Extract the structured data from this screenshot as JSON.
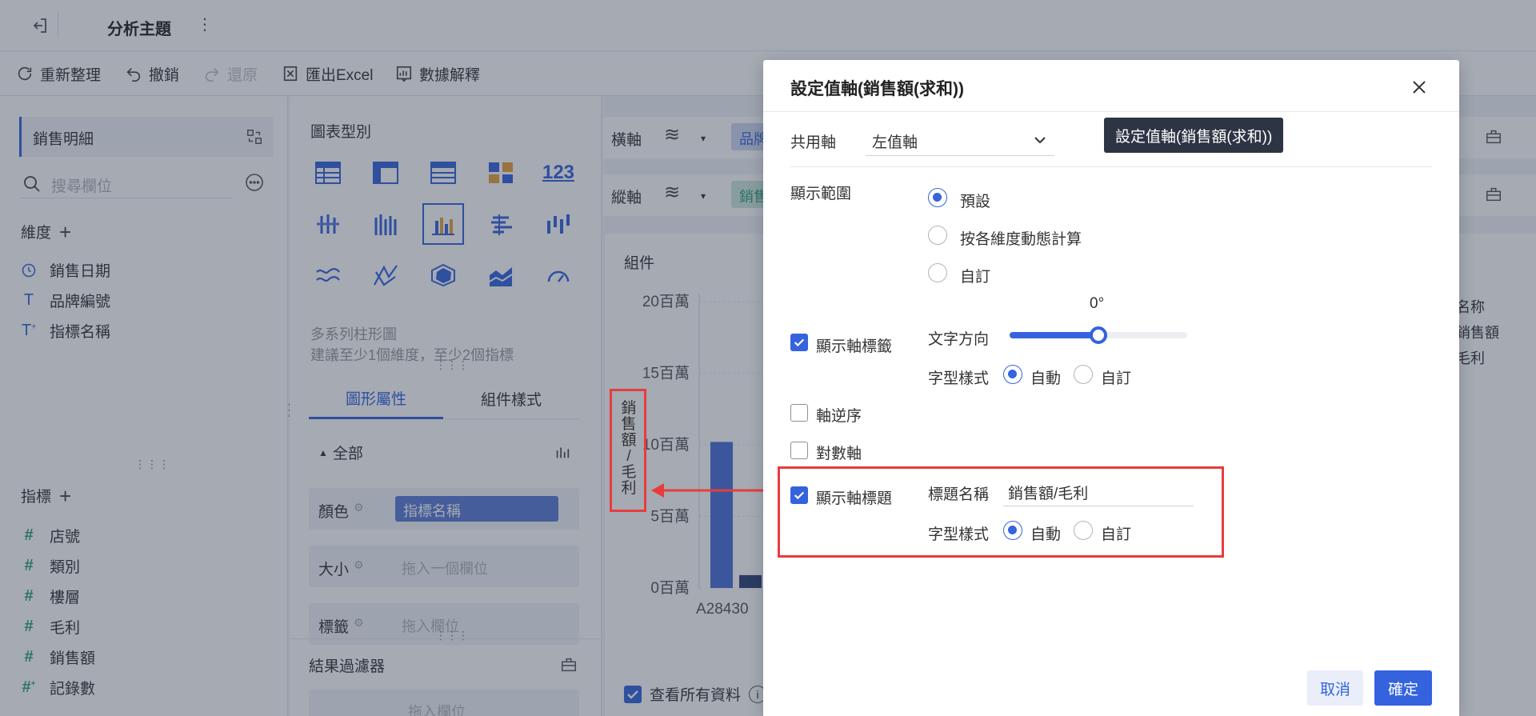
{
  "topbar": {
    "title": "分析主題"
  },
  "toolbar": {
    "refresh": "重新整理",
    "undo": "撤銷",
    "redo": "還原",
    "export": "匯出Excel",
    "explain": "數據解釋"
  },
  "left": {
    "dataset": "銷售明細",
    "search_placeholder": "搜尋欄位",
    "dimensions_label": "維度",
    "dimensions": [
      "銷售日期",
      "品牌編號",
      "指標名稱"
    ],
    "measures_label": "指標",
    "measures": [
      "店號",
      "類別",
      "樓層",
      "毛利",
      "銷售額",
      "記錄數"
    ]
  },
  "middle": {
    "chart_type_label": "圖表型別",
    "chart_desc_title": "多系列柱形圖",
    "chart_desc_hint": "建議至少1個維度，至少2個指標",
    "tab_graphic": "圖形屬性",
    "tab_component": "組件樣式",
    "all_label": "全部",
    "color_label": "顏色",
    "color_value": "指標名稱",
    "size_label": "大小",
    "size_placeholder": "拖入一個欄位",
    "tag_label": "標籤",
    "tag_placeholder": "拖入欄位",
    "filter_label": "結果過濾器",
    "filter_placeholder": "拖入欄位"
  },
  "right": {
    "x_axis_label": "橫軸",
    "x_pill": "品牌",
    "y_axis_label": "縱軸",
    "y_pill": "銷售",
    "component_label": "組件",
    "y_ticks": [
      "20百萬",
      "15百萬",
      "10百萬",
      "5百萬",
      "0百萬"
    ],
    "axis_title_chars": [
      "銷",
      "售",
      "額",
      "/",
      "毛",
      "利"
    ],
    "x_category": "A28430",
    "legend_title": "名称",
    "legend_items": [
      "銷售額",
      "毛利"
    ],
    "view_all": "查看所有資料"
  },
  "chart_data": {
    "type": "bar",
    "categories": [
      "A28430"
    ],
    "series": [
      {
        "name": "銷售額",
        "values": [
          10.2
        ]
      },
      {
        "name": "毛利",
        "values": [
          0.9
        ]
      }
    ],
    "ylabel": "銷售額/毛利",
    "ylim": [
      0,
      20
    ],
    "y_unit": "百萬",
    "colors": [
      "#4a6fd8",
      "#2e4275"
    ]
  },
  "dialog": {
    "title": "設定值軸(銷售額(求和))",
    "shared_axis_label": "共用軸",
    "shared_axis_value": "左值軸",
    "tooltip": "設定值軸(銷售額(求和))",
    "range_label": "顯示範圍",
    "range_options": [
      "預設",
      "按各維度動態計算",
      "自訂"
    ],
    "range_selected": "預設",
    "show_axis_label": "顯示軸標籤",
    "angle_value": "0°",
    "text_direction_label": "文字方向",
    "slider_fraction": 0.5,
    "font_style_label": "字型樣式",
    "font_auto": "自動",
    "font_custom": "自訂",
    "reverse_axis_label": "軸逆序",
    "log_axis_label": "對數軸",
    "show_axis_title_label": "顯示軸標題",
    "title_name_label": "標題名稱",
    "title_name_value": "銷售額/毛利",
    "font_style_label2": "字型樣式",
    "font_auto2": "自動",
    "font_custom2": "自訂",
    "cancel": "取消",
    "confirm": "確定"
  },
  "colors": {
    "accent": "#3563dd",
    "highlight": "#e83c3c"
  }
}
